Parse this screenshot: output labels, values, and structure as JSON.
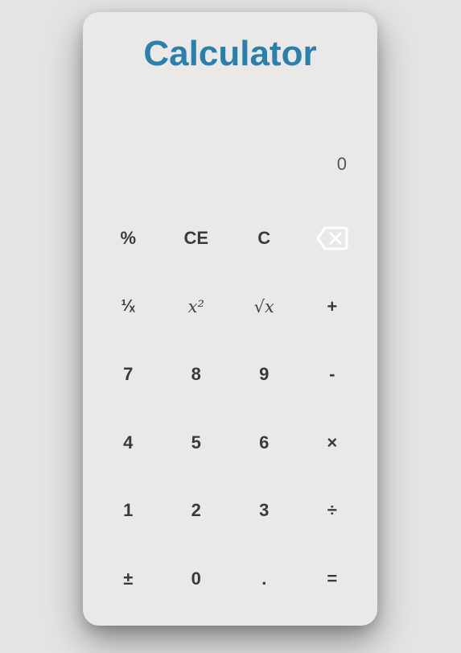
{
  "app": {
    "title": "Calculator"
  },
  "display": {
    "value": "0"
  },
  "keys": [
    {
      "name": "percent-button",
      "label": "%",
      "kind": "text"
    },
    {
      "name": "clear-entry-button",
      "label": "CE",
      "kind": "text"
    },
    {
      "name": "clear-button",
      "label": "C",
      "kind": "text"
    },
    {
      "name": "backspace-button",
      "label": "",
      "kind": "icon",
      "icon": "backspace-icon"
    },
    {
      "name": "reciprocal-button",
      "label": "¹⁄ₓ",
      "kind": "frac"
    },
    {
      "name": "square-button",
      "label": "𝑥²",
      "kind": "math"
    },
    {
      "name": "square-root-button",
      "label": "√𝑥",
      "kind": "math"
    },
    {
      "name": "add-button",
      "label": "+",
      "kind": "text"
    },
    {
      "name": "digit-7-button",
      "label": "7",
      "kind": "text"
    },
    {
      "name": "digit-8-button",
      "label": "8",
      "kind": "text"
    },
    {
      "name": "digit-9-button",
      "label": "9",
      "kind": "text"
    },
    {
      "name": "subtract-button",
      "label": "-",
      "kind": "text"
    },
    {
      "name": "digit-4-button",
      "label": "4",
      "kind": "text"
    },
    {
      "name": "digit-5-button",
      "label": "5",
      "kind": "text"
    },
    {
      "name": "digit-6-button",
      "label": "6",
      "kind": "text"
    },
    {
      "name": "multiply-button",
      "label": "×",
      "kind": "text"
    },
    {
      "name": "digit-1-button",
      "label": "1",
      "kind": "text"
    },
    {
      "name": "digit-2-button",
      "label": "2",
      "kind": "text"
    },
    {
      "name": "digit-3-button",
      "label": "3",
      "kind": "text"
    },
    {
      "name": "divide-button",
      "label": "÷",
      "kind": "text"
    },
    {
      "name": "negate-button",
      "label": "±",
      "kind": "text"
    },
    {
      "name": "digit-0-button",
      "label": "0",
      "kind": "text"
    },
    {
      "name": "decimal-button",
      "label": ".",
      "kind": "text"
    },
    {
      "name": "equals-button",
      "label": "=",
      "kind": "text"
    }
  ],
  "colors": {
    "title": "#2a80ab",
    "key_text": "#3a3a3a",
    "card_bg": "#ebe8e8",
    "page_bg": "#e6e4e3",
    "backspace_icon": "#ffffff"
  }
}
